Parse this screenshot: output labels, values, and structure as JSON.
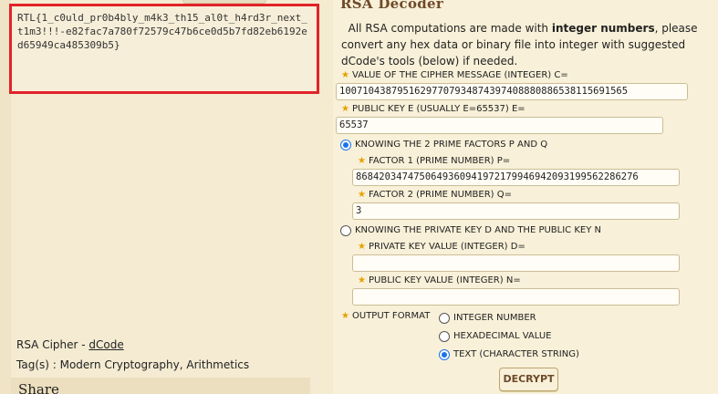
{
  "result": {
    "text": "RTL{1_c0uld_pr0b4bly_m4k3_th15_al0t_h4rd3r_next_t1m3!!!-e82fac7a780f72579c47b6ce0d5b7fd82eb6192ed65949ca485309b5}"
  },
  "footer": {
    "tool_name": "RSA Cipher",
    "separator": " - ",
    "tool_link": "dCode",
    "tags_label": "Tag(s) : ",
    "tags": "Modern Cryptography, Arithmetics",
    "share_title": "Share"
  },
  "decoder": {
    "title": "RSA Decoder",
    "intro_pre": "All RSA computations are made with ",
    "intro_bold": "integer numbers",
    "intro_post": ", please convert any hex data or binary file into integer with suggested dCode's tools (below) if needed.",
    "cipher_label": "VALUE OF THE CIPHER MESSAGE (INTEGER) C=",
    "cipher_value": "10071043879516297707934874397408880886538115691565",
    "pubkey_label": "PUBLIC KEY E (USUALLY E=65537) E=",
    "pubkey_value": "65537",
    "option_primes": "KNOWING THE 2 PRIME FACTORS P AND Q",
    "factor1_label": "FACTOR 1 (PRIME NUMBER) P=",
    "factor1_value": "8684203474750649360941972179946942093199562286276",
    "factor2_label": "FACTOR 2 (PRIME NUMBER) Q=",
    "factor2_value": "3",
    "option_private": "KNOWING THE PRIVATE KEY D AND THE PUBLIC KEY N",
    "private_label": "PRIVATE KEY VALUE (INTEGER) D=",
    "private_value": "",
    "public_n_label": "PUBLIC KEY VALUE (INTEGER) N=",
    "public_n_value": "",
    "output_label": "OUTPUT FORMAT",
    "format_integer": "INTEGER NUMBER",
    "format_hex": "HEXADECIMAL VALUE",
    "format_text": "TEXT (CHARACTER STRING)",
    "decrypt_label": "DECRYPT"
  },
  "colors": {
    "highlight_border": "#e1232a",
    "title_brown": "#6f4a2a",
    "star": "#e6a100",
    "radio_selected": "#1a73e8"
  }
}
